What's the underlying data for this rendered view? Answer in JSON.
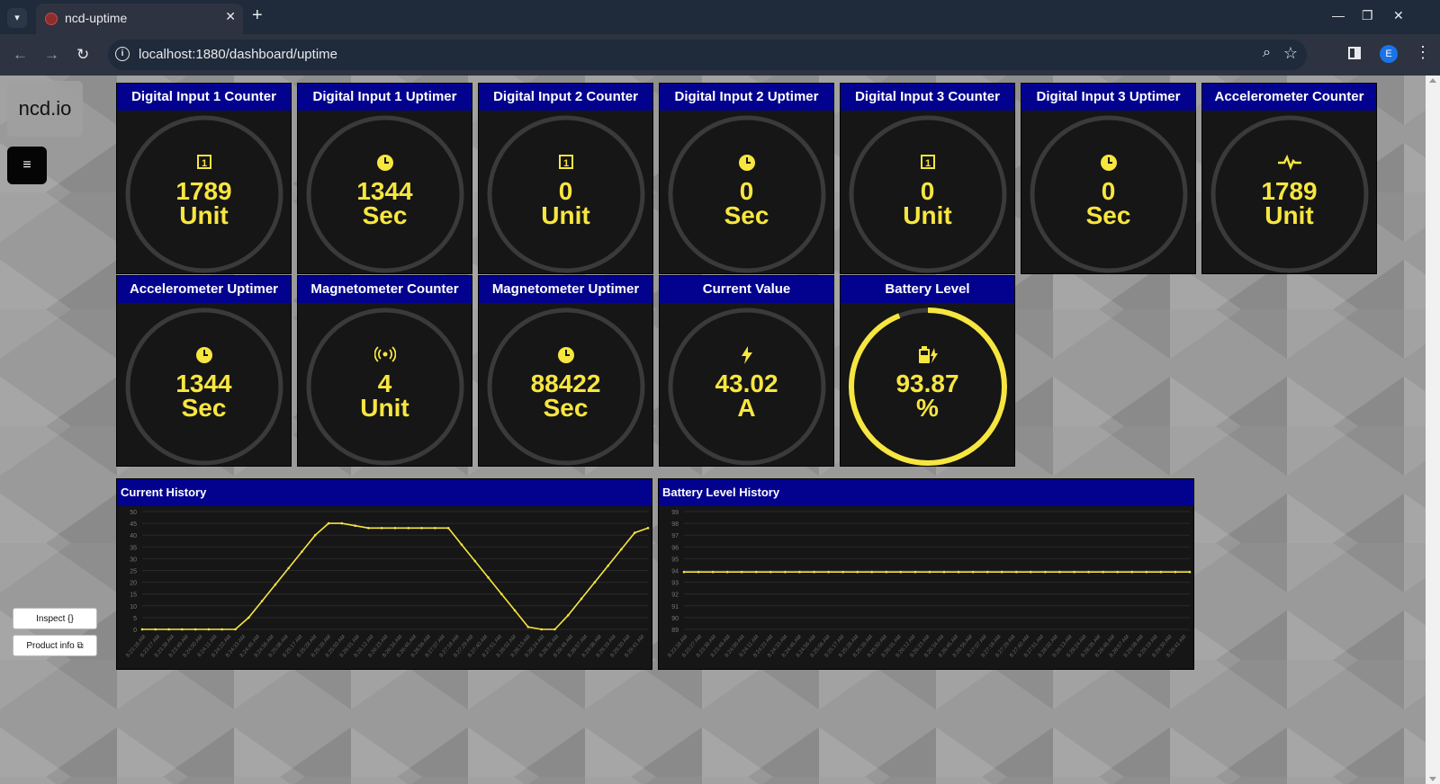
{
  "browser": {
    "tab_title": "ncd-uptime",
    "tab_close": "✕",
    "new_tab": "+",
    "url": "localhost:1880/dashboard/uptime",
    "profile_initial": "E",
    "icons": [
      "tab-list-icon",
      "favicon-icon",
      "close-icon",
      "new-tab-icon",
      "minimize-icon",
      "maximize-icon",
      "window-close-icon",
      "back-icon",
      "forward-icon",
      "reload-icon",
      "site-info-icon",
      "zoom-icon",
      "bookmark-star-icon",
      "side-panel-icon",
      "profile-icon",
      "kebab-menu-icon"
    ]
  },
  "sidebar": {
    "logo": "ncd.io",
    "menu_icon": "hamburger-icon",
    "inspect_label": "Inspect {}",
    "product_info_label": "Product info ⧉"
  },
  "colors": {
    "header_blue": "#02028f",
    "gauge_yellow": "#f7e640",
    "card_bg": "#161616"
  },
  "gauges": [
    {
      "title": "Digital Input 1 Counter",
      "icon": "input-1-icon",
      "value": "1789",
      "unit": "Unit",
      "fill": 0
    },
    {
      "title": "Digital Input 1 Uptimer",
      "icon": "clock-icon",
      "value": "1344",
      "unit": "Sec",
      "fill": 0
    },
    {
      "title": "Digital Input 2 Counter",
      "icon": "input-1-icon",
      "value": "0",
      "unit": "Unit",
      "fill": 0
    },
    {
      "title": "Digital Input 2 Uptimer",
      "icon": "clock-icon",
      "value": "0",
      "unit": "Sec",
      "fill": 0
    },
    {
      "title": "Digital Input 3 Counter",
      "icon": "input-1-icon",
      "value": "0",
      "unit": "Unit",
      "fill": 0
    },
    {
      "title": "Digital Input 3 Uptimer",
      "icon": "clock-icon",
      "value": "0",
      "unit": "Sec",
      "fill": 0
    },
    {
      "title": "Accelerometer Counter",
      "icon": "pulse-icon",
      "value": "1789",
      "unit": "Unit",
      "fill": 0
    },
    {
      "title": "Accelerometer Uptimer",
      "icon": "clock-icon",
      "value": "1344",
      "unit": "Sec",
      "fill": 0
    },
    {
      "title": "Magnetometer Counter",
      "icon": "signal-icon",
      "value": "4",
      "unit": "Unit",
      "fill": 0
    },
    {
      "title": "Magnetometer Uptimer",
      "icon": "clock-icon",
      "value": "88422",
      "unit": "Sec",
      "fill": 0
    },
    {
      "title": "Current Value",
      "icon": "bolt-icon",
      "value": "43.02",
      "unit": "A",
      "fill": 0
    },
    {
      "title": "Battery Level",
      "icon": "battery-charging-icon",
      "value": "93.87",
      "unit": "%",
      "fill": 0.9387
    }
  ],
  "chart_data": [
    {
      "type": "line",
      "title": "Current History",
      "ylim": [
        0,
        50
      ],
      "yticks": [
        0,
        5,
        10,
        15,
        20,
        25,
        30,
        35,
        40,
        45,
        50
      ],
      "x": [
        "8:23:18 AM",
        "8:23:27 AM",
        "8:23:38 AM",
        "8:23:49 AM",
        "8:24:00 AM",
        "8:24:11 AM",
        "8:24:22 AM",
        "8:24:33 AM",
        "8:24:45 AM",
        "8:24:56 AM",
        "8:25:06 AM",
        "8:25:17 AM",
        "8:25:28 AM",
        "8:25:39 AM",
        "8:25:50 AM",
        "8:26:01 AM",
        "8:26:12 AM",
        "8:26:23 AM",
        "8:26:34 AM",
        "8:26:45 AM",
        "8:26:56 AM",
        "8:27:07 AM",
        "8:27:18 AM",
        "8:27:29 AM",
        "8:27:40 AM",
        "8:27:51 AM",
        "8:28:02 AM",
        "8:28:13 AM",
        "8:28:24 AM",
        "8:28:35 AM",
        "8:28:46 AM",
        "8:28:57 AM",
        "8:29:08 AM",
        "8:29:19 AM",
        "8:29:30 AM",
        "8:29:41 AM"
      ],
      "series": [
        {
          "values": [
            0,
            0,
            0,
            0,
            0,
            0,
            0,
            0,
            5,
            12,
            19,
            26,
            33,
            40,
            45,
            45,
            44,
            43,
            43,
            43,
            43,
            43,
            43,
            43,
            36,
            29,
            22,
            15,
            8,
            1,
            0,
            0,
            6,
            13,
            20,
            27,
            34,
            41,
            43
          ]
        }
      ],
      "grid": true
    },
    {
      "type": "line",
      "title": "Battery Level History",
      "ylim": [
        89,
        99
      ],
      "yticks": [
        89,
        90,
        91,
        92,
        93,
        94,
        95,
        96,
        97,
        98,
        99
      ],
      "x": [
        "8:23:18 AM",
        "8:23:27 AM",
        "8:23:38 AM",
        "8:23:49 AM",
        "8:24:00 AM",
        "8:24:11 AM",
        "8:24:22 AM",
        "8:24:33 AM",
        "8:24:45 AM",
        "8:24:56 AM",
        "8:25:06 AM",
        "8:25:17 AM",
        "8:25:28 AM",
        "8:25:39 AM",
        "8:25:50 AM",
        "8:26:01 AM",
        "8:26:12 AM",
        "8:26:23 AM",
        "8:26:34 AM",
        "8:26:45 AM",
        "8:26:56 AM",
        "8:27:07 AM",
        "8:27:18 AM",
        "8:27:29 AM",
        "8:27:40 AM",
        "8:27:51 AM",
        "8:28:02 AM",
        "8:28:13 AM",
        "8:28:24 AM",
        "8:28:35 AM",
        "8:28:46 AM",
        "8:28:57 AM",
        "8:29:08 AM",
        "8:29:19 AM",
        "8:29:30 AM",
        "8:29:41 AM"
      ],
      "series": [
        {
          "values": [
            93.87,
            93.87,
            93.87,
            93.87,
            93.87,
            93.87,
            93.87,
            93.87,
            93.87,
            93.87,
            93.87,
            93.87,
            93.87,
            93.87,
            93.87,
            93.87,
            93.87,
            93.87,
            93.87,
            93.87,
            93.87,
            93.87,
            93.87,
            93.87,
            93.87,
            93.87,
            93.87,
            93.87,
            93.87,
            93.87,
            93.87,
            93.87,
            93.87,
            93.87,
            93.87,
            93.87
          ]
        }
      ],
      "grid": true
    }
  ]
}
